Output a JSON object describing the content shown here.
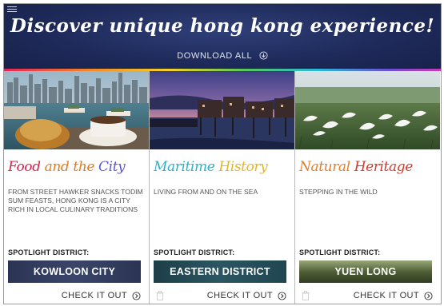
{
  "header": {
    "headline": "Discover unique hong kong experience!",
    "download_label": "DOWNLOAD ALL",
    "menu_icon": "hamburger-menu-icon",
    "download_icon": "download-circle-icon"
  },
  "colors": {
    "header_bg": "#1e2a5a",
    "food_title": "#d8234e",
    "maritime_title": "#2ab3c8",
    "heritage_title": "#d33a2c"
  },
  "cards": [
    {
      "title_parts": [
        "Food ",
        "and the ",
        "City"
      ],
      "description": "FROM STREET HAWKER SNACKS TODIM SUM FEASTS, HONG KONG IS A CITY RICH IN LOCAL CULINARY TRADITIONS",
      "spotlight_label": "SPOTLIGHT DISTRICT:",
      "district": "KOWLOON CITY",
      "cta": "CHECK IT OUT"
    },
    {
      "title_parts": [
        "Maritime ",
        "History"
      ],
      "description": "LIVING FROM AND ON THE SEA",
      "spotlight_label": "SPOTLIGHT DISTRICT:",
      "district": "EASTERN DISTRICT",
      "cta": "CHECK IT OUT"
    },
    {
      "title_parts": [
        "Natural ",
        "Heritage"
      ],
      "description": "STEPPING IN THE WILD",
      "spotlight_label": "SPOTLIGHT DISTRICT:",
      "district": "YUEN LONG",
      "cta": "CHECK IT OUT"
    }
  ]
}
